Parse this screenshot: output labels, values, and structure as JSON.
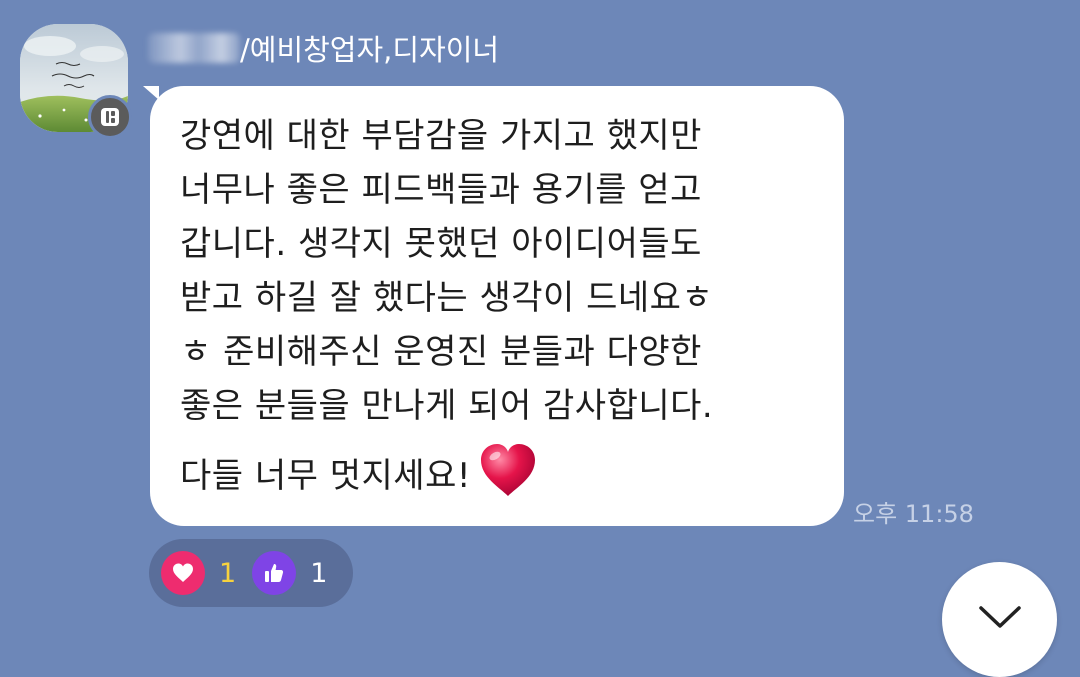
{
  "sender": {
    "name_suffix": "/예비창업자,디자이너"
  },
  "message": {
    "lines": [
      "강연에 대한 부담감을 가지고 했지만",
      "너무나 좋은 피드백들과 용기를 얻고",
      "갑니다. 생각지 못했던 아이디어들도",
      "받고 하길 잘 했다는 생각이 드네요ㅎ",
      "ㅎ 준비해주신 운영진 분들과 다양한",
      "좋은 분들을 만나게 되어 감사합니다."
    ],
    "last_line": "다들 너무 멋지세요!",
    "time": "오후 11:58"
  },
  "reactions": [
    {
      "icon": "heart-icon",
      "count": "1",
      "color": "#ee2c6f"
    },
    {
      "icon": "thumbs-up-icon",
      "count": "1",
      "color": "#7f44e6"
    }
  ],
  "colors": {
    "background": "#6d87b8",
    "bubble": "#ffffff",
    "reaction_pill": "#5a6e9a",
    "time_text": "#c6d1e6"
  },
  "icons": {
    "avatar_badge": "profile-card-icon",
    "scroll_button": "chevron-down-icon",
    "emoji": "red-heart-emoji"
  }
}
